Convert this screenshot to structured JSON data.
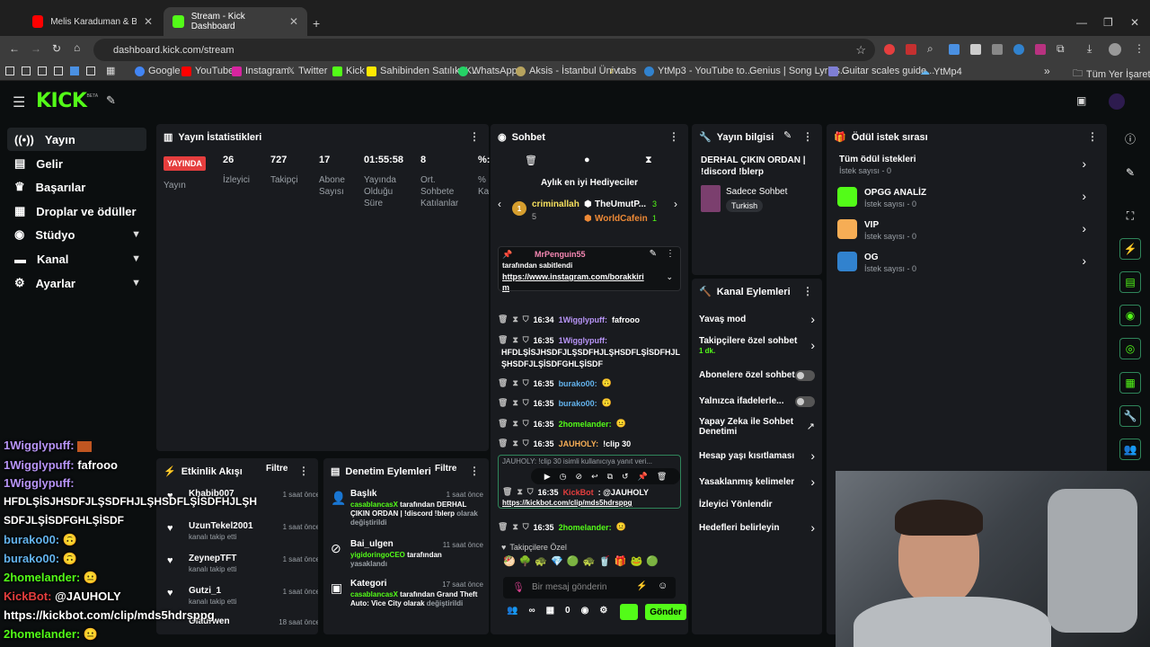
{
  "browser": {
    "tabs": [
      {
        "title": "Melis Karaduman & Birkan Nas...",
        "active": false
      },
      {
        "title": "Stream - Kick Dashboard",
        "active": true
      }
    ],
    "url": "dashboard.kick.com/stream",
    "bookmarks": [
      "Google",
      "YouTube",
      "Instagram",
      "Twitter",
      "Kick",
      "Sahibinden Satılık, K...",
      "WhatsApp",
      "Aksis - İstanbul Üniv...",
      "tabs",
      "YtMp3 - YouTube to...",
      "Genius | Song Lyrics...",
      "Guitar scales guide...",
      "YtMp4"
    ],
    "all_bookmarks": "Tüm Yer İşaretleri"
  },
  "sidebar": {
    "items": [
      {
        "label": "Yayın",
        "icon": "broadcast-icon"
      },
      {
        "label": "Gelir",
        "icon": "dollar-icon"
      },
      {
        "label": "Başarılar",
        "icon": "trophy-icon"
      },
      {
        "label": "Droplar ve ödüller",
        "icon": "gift-icon"
      },
      {
        "label": "Stüdyo",
        "icon": "studio-icon"
      },
      {
        "label": "Kanal",
        "icon": "channel-icon"
      },
      {
        "label": "Ayarlar",
        "icon": "gear-icon"
      }
    ],
    "logo": "KICK",
    "logo_badge": "BETA"
  },
  "stats": {
    "title": "Yayın İstatistikleri",
    "live_badge": "YAYINDA",
    "yayin": "Yayın",
    "items": [
      {
        "value": "26",
        "label": "İzleyici"
      },
      {
        "value": "727",
        "label": "Takipçi"
      },
      {
        "value": "17",
        "label": "Abone Sayısı"
      },
      {
        "value": "01:55:58",
        "label": "Yayında Olduğu Süre"
      },
      {
        "value": "8",
        "label": "Ort. Sohbete Katılanlar"
      },
      {
        "value": "%:",
        "label": "% Ka"
      }
    ]
  },
  "activity": {
    "title": "Etkinlik Akışı",
    "filter": "Filtre",
    "items": [
      {
        "name": "Khabib007",
        "sub": "",
        "time": "1 saat önce"
      },
      {
        "name": "UzunTekel2001",
        "sub": "kanalı takip etti",
        "time": "1 saat önce"
      },
      {
        "name": "ZeynepTFT",
        "sub": "kanalı takip etti",
        "time": "1 saat önce"
      },
      {
        "name": "Gutzi_1",
        "sub": "kanalı takip etti",
        "time": "1 saat önce"
      },
      {
        "name": "Glaurwen",
        "sub": "",
        "time": "18 saat önce"
      }
    ]
  },
  "moderation": {
    "title": "Denetim Eylemleri",
    "filter": "Filtre",
    "items": [
      {
        "title": "Başlık",
        "time": "1 saat önce",
        "user": "casablancasX",
        "text": " tarafından DERHAL ÇIKIN ORDAN | !discord !blerp",
        "tail": "olarak değiştirildi"
      },
      {
        "title": "Bai_ulgen",
        "time": "11 saat önce",
        "user": "yigidoringoCEO",
        "text": " tarafından",
        "tail": "yasaklandı"
      },
      {
        "title": "Kategori",
        "time": "17 saat önce",
        "user": "casablancasX",
        "text": " tarafından Grand Theft Auto: Vice City olarak",
        "tail": "değiştirildi"
      }
    ]
  },
  "chat": {
    "title": "Sohbet",
    "gifters_title": "Aylık en iyi Hediyeciler",
    "gifters": [
      {
        "name": "criminallah",
        "count": "5",
        "rank": "1"
      },
      {
        "name": "TheUmutP...",
        "count": "3"
      },
      {
        "name": "WorldCafein",
        "count": "1"
      }
    ],
    "pinned": {
      "user": "MrPenguin55",
      "by": "tarafından sabitlendi",
      "link": "https://www.instagram.com/borakkiri",
      "link2": "m"
    },
    "messages": [
      {
        "time": "16:34",
        "user": "1Wigglypuff:",
        "text": "fafrooo",
        "color": "#b794f6"
      },
      {
        "time": "16:35",
        "user": "1Wigglypuff:",
        "text": "",
        "color": "#b794f6"
      },
      {
        "time": "16:35",
        "user": "burako00:",
        "text": "",
        "color": "#63b3ed"
      },
      {
        "time": "16:35",
        "user": "burako00:",
        "text": "",
        "color": "#63b3ed"
      },
      {
        "time": "16:35",
        "user": "2homelander:",
        "text": "",
        "color": "#53fc18"
      },
      {
        "time": "16:35",
        "user": "JAUHOLY:",
        "text": "!clip 30",
        "color": "#f6ad55"
      },
      {
        "time": "16:35",
        "user": "KickBot",
        "text": ": @JAUHOLY",
        "color": "#e53e3e"
      },
      {
        "time": "16:35",
        "user": "2homelander:",
        "text": "",
        "color": "#53fc18"
      }
    ],
    "long_msg_1": "HFDLŞİSJHSDFJLŞSDFHJLŞHSDFLŞİSDFHJL",
    "long_msg_2": "ŞHSDFJLŞİSDFGHLŞİSDF",
    "reply_preview": "JAUHOLY: !clip 30 isimli kullanıcıya yanıt veri...",
    "bot_link": "https://kickbot.com/clip/mds5hdrsppg",
    "followers_only": "Takipçilere Özel",
    "input_placeholder": "Bir mesaj gönderin",
    "send": "Gönder",
    "points": "0"
  },
  "stream_info": {
    "title": "Yayın bilgisi",
    "stream_title": "DERHAL ÇIKIN ORDAN | !discord !blerp",
    "category": "Sadece Sohbet",
    "tag": "Turkish"
  },
  "channel_actions": {
    "title": "Kanal Eylemleri",
    "items": [
      {
        "label": "Yavaş mod",
        "control": "arrow"
      },
      {
        "label": "Takipçilere özel sohbet",
        "sub": "1 dk.",
        "control": "arrow"
      },
      {
        "label": "Abonelere özel sohbet",
        "control": "toggle"
      },
      {
        "label": "Yalnızca ifadelerle...",
        "control": "toggle"
      },
      {
        "label": "Yapay Zeka ile Sohbet Denetimi",
        "control": "external"
      },
      {
        "label": "Hesap yaşı kısıtlaması",
        "control": "arrow"
      },
      {
        "label": "Yasaklanmış kelimeler",
        "control": "arrow"
      },
      {
        "label": "İzleyici Yönlendir",
        "control": "none"
      },
      {
        "label": "Hedefleri belirleyin",
        "control": "arrow"
      }
    ]
  },
  "rewards": {
    "title": "Ödül istek sırası",
    "items": [
      {
        "name": "Tüm ödül istekleri",
        "sub": "İstek sayısı - 0",
        "color": ""
      },
      {
        "name": "OPGG ANALİZ",
        "sub": "İstek sayısı - 0",
        "color": "#53fc18"
      },
      {
        "name": "VIP",
        "sub": "İstek sayısı - 0",
        "color": "#f6ad55"
      },
      {
        "name": "OG",
        "sub": "İstek sayısı - 0",
        "color": "#3182ce"
      }
    ]
  },
  "overlay_chat": [
    {
      "user": "1Wigglypuff:",
      "text": "",
      "color": "#b794f6"
    },
    {
      "user": "1Wigglypuff:",
      "text": "fafrooo",
      "color": "#b794f6"
    },
    {
      "user": "1Wigglypuff:",
      "text": "",
      "color": "#b794f6"
    },
    {
      "user": "",
      "text": "HFDLŞİSJHSDFJLŞSDFHJLŞHSDFLŞİSDFHJLŞH",
      "color": "#fff"
    },
    {
      "user": "",
      "text": "SDFJLŞİSDFGHLŞİSDF",
      "color": "#fff"
    },
    {
      "user": "burako00:",
      "text": "",
      "color": "#63b3ed"
    },
    {
      "user": "burako00:",
      "text": "",
      "color": "#63b3ed"
    },
    {
      "user": "2homelander:",
      "text": "",
      "color": "#53fc18"
    },
    {
      "user": "KickBot:",
      "text": "@JAUHOLY",
      "color": "#e53e3e"
    },
    {
      "user": "",
      "text": "https://kickbot.com/clip/mds5hdrsppg",
      "color": "#fff"
    },
    {
      "user": "2homelander:",
      "text": "",
      "color": "#53fc18"
    }
  ]
}
